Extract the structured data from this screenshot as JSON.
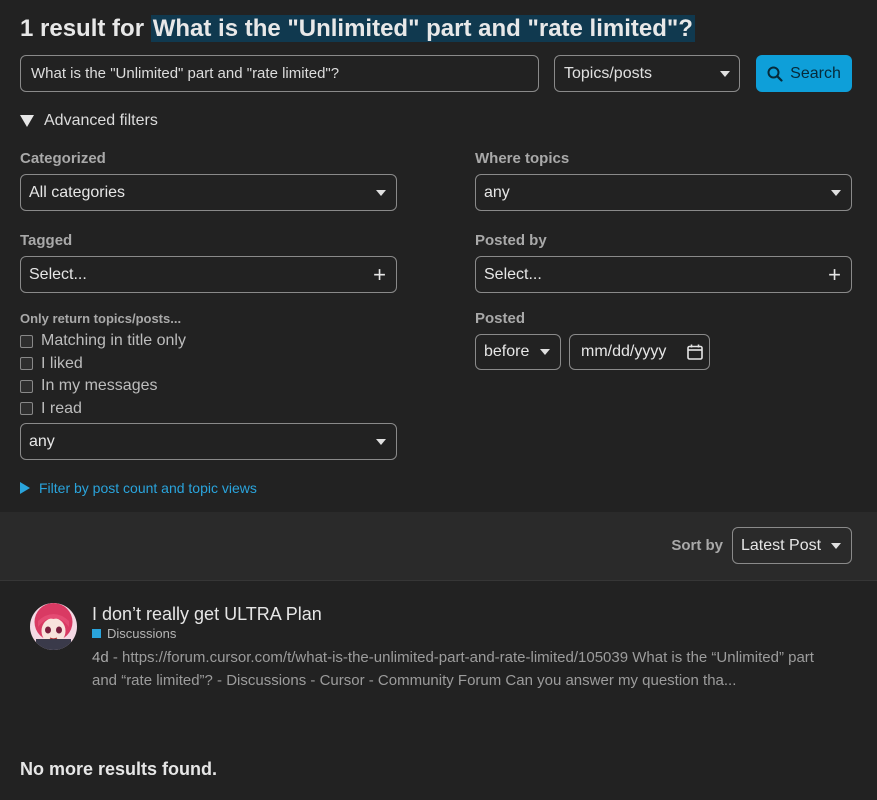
{
  "heading": {
    "prefix": "1 result for",
    "term": "What is the \"Unlimited\" part and \"rate limited\"?"
  },
  "search": {
    "value": "What is the \"Unlimited\" part and \"rate limited\"?",
    "type_select": "Topics/posts",
    "button_label": "Search",
    "accent_color": "#0e9fd9"
  },
  "advanced": {
    "toggle_label": "Advanced filters",
    "categorized": {
      "label": "Categorized",
      "value": "All categories"
    },
    "tagged": {
      "label": "Tagged",
      "value": "Select..."
    },
    "only_return": {
      "label": "Only return topics/posts...",
      "options": [
        {
          "label": "Matching in title only",
          "checked": false
        },
        {
          "label": "I liked",
          "checked": false
        },
        {
          "label": "In my messages",
          "checked": false
        },
        {
          "label": "I read",
          "checked": false
        }
      ],
      "select_value": "any"
    },
    "post_count_link": "Filter by post count and topic views",
    "where_topics": {
      "label": "Where topics",
      "value": "any"
    },
    "posted_by": {
      "label": "Posted by",
      "value": "Select..."
    },
    "posted": {
      "label": "Posted",
      "before_value": "before",
      "date_placeholder": "mm/dd/yyyy"
    }
  },
  "sort": {
    "label": "Sort by",
    "value": "Latest Post"
  },
  "results": [
    {
      "title": "I don’t really get ULTRA Plan",
      "category": "Discussions",
      "category_color": "#2aa4dc",
      "date": "4d",
      "blurb": "https://forum.cursor.com/t/what-is-the-unlimited-part-and-rate-limited/105039 What is the “Unlimited” part and “rate limited”? - Discussions - Cursor - Community Forum Can you answer my question tha..."
    }
  ],
  "footer": {
    "no_more": "No more results found."
  }
}
